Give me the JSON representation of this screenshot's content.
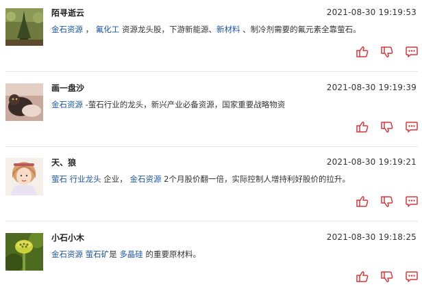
{
  "colors": {
    "accent": "#d9353a",
    "link": "#1a56a8",
    "text": "#333333",
    "divider": "#e6e6e6"
  },
  "actions": {
    "like_icon": "thumbs-up-icon",
    "dislike_icon": "thumbs-down-icon",
    "reply_icon": "comment-icon"
  },
  "comments": [
    {
      "user": "陌寻逝云",
      "time": "2021-08-30 19:19:53",
      "segments": [
        {
          "text": "金石资源",
          "hl": true
        },
        {
          "text": " ， ",
          "hl": false
        },
        {
          "text": "氟化工",
          "hl": true
        },
        {
          "text": " 资源龙头股，下游新能源、",
          "hl": false
        },
        {
          "text": "新材料",
          "hl": true
        },
        {
          "text": " 、制冷剂需要的氟元素全靠萤石。",
          "hl": false
        }
      ],
      "avatar": "avatar-forest"
    },
    {
      "user": "画一盘沙",
      "time": "2021-08-30 19:19:39",
      "segments": [
        {
          "text": "金石资源",
          "hl": true
        },
        {
          "text": " -萤石行业的龙头，新兴产业必备资源，国家重要战略物资",
          "hl": false
        }
      ],
      "avatar": "avatar-cat"
    },
    {
      "user": "天、狼",
      "time": "2021-08-30 19:19:21",
      "segments": [
        {
          "text": "萤石",
          "hl": true
        },
        {
          "text": " ",
          "hl": false
        },
        {
          "text": "行业龙头",
          "hl": true
        },
        {
          "text": " 企业， ",
          "hl": false
        },
        {
          "text": "金石资源",
          "hl": true
        },
        {
          "text": " 2个月股价翻一倍，实际控制人增持利好股价的拉升。",
          "hl": false
        }
      ],
      "avatar": "avatar-girl"
    },
    {
      "user": "小石小木",
      "time": "2021-08-30 19:18:25",
      "segments": [
        {
          "text": "金石资源",
          "hl": true
        },
        {
          "text": " ",
          "hl": false
        },
        {
          "text": "萤石矿",
          "hl": true
        },
        {
          "text": "是 ",
          "hl": false
        },
        {
          "text": "多晶硅",
          "hl": true
        },
        {
          "text": " 的重要原材料。",
          "hl": false
        }
      ],
      "avatar": "avatar-lotus"
    }
  ]
}
